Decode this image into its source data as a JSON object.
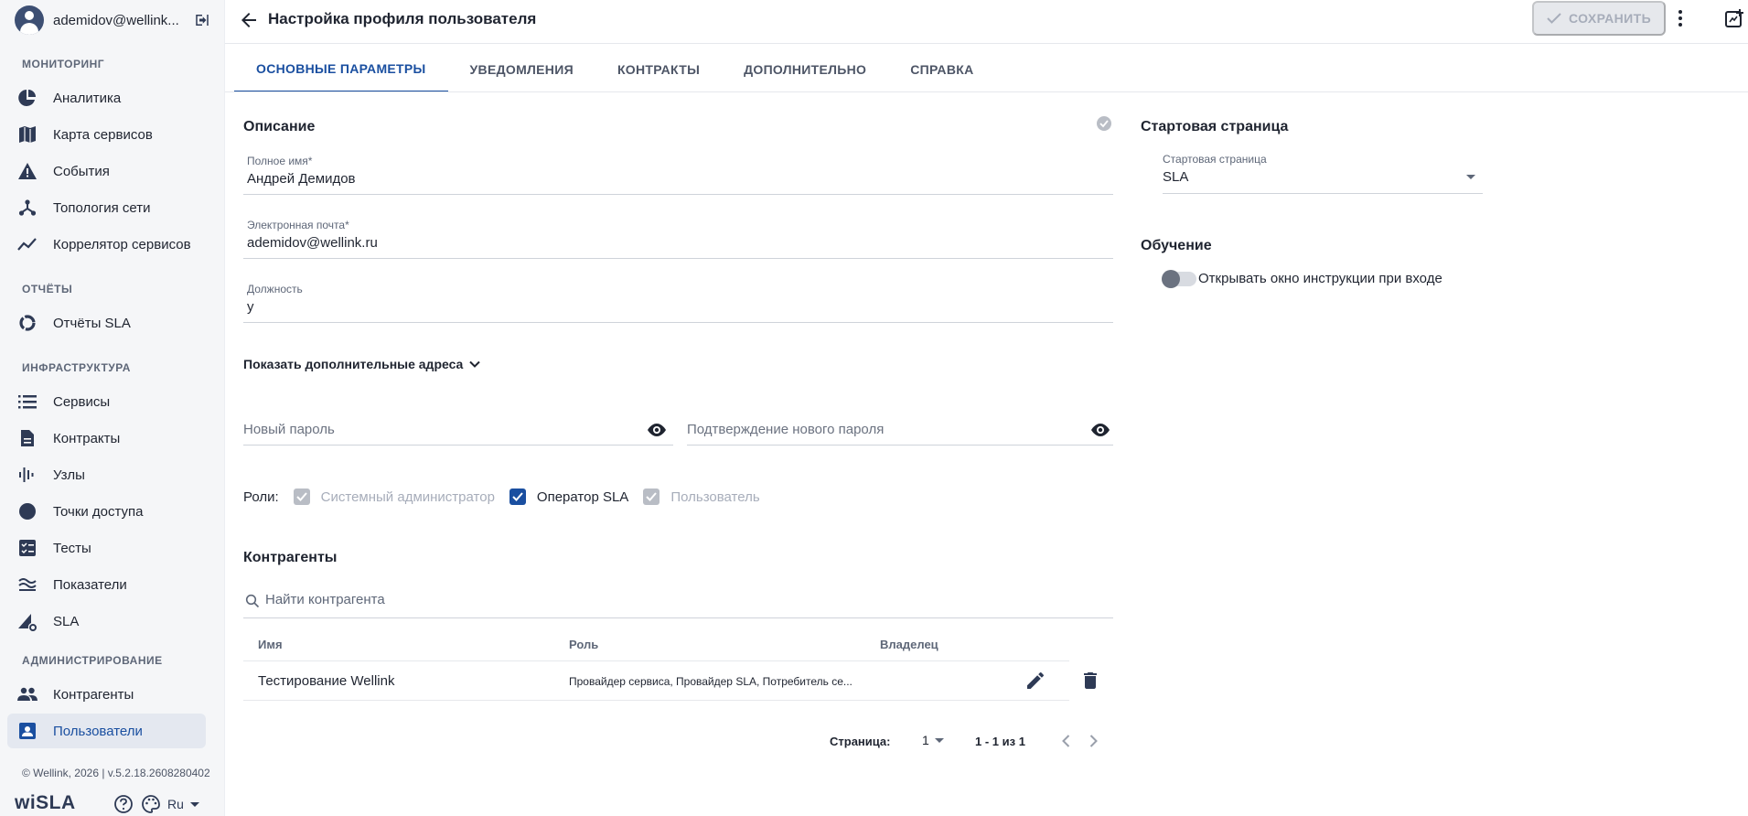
{
  "user": {
    "email": "ademidov@wellink..."
  },
  "sidebar": {
    "sections": [
      {
        "title": "МОНИТОРИНГ"
      },
      {
        "title": "ОТЧЁТЫ"
      },
      {
        "title": "ИНФРАСТРУКТУРА"
      },
      {
        "title": "АДМИНИСТРИРОВАНИЕ"
      }
    ],
    "items": [
      {
        "label": "Аналитика",
        "icon": "pie-chart-icon"
      },
      {
        "label": "Карта сервисов",
        "icon": "map-icon"
      },
      {
        "label": "События",
        "icon": "warning-icon"
      },
      {
        "label": "Топология сети",
        "icon": "topology-icon"
      },
      {
        "label": "Коррелятор сервисов",
        "icon": "trend-icon"
      },
      {
        "label": "Отчёты SLA",
        "icon": "donut-icon"
      },
      {
        "label": "Сервисы",
        "icon": "list-icon"
      },
      {
        "label": "Контракты",
        "icon": "document-icon"
      },
      {
        "label": "Узлы",
        "icon": "equalizer-icon"
      },
      {
        "label": "Точки доступа",
        "icon": "circle-icon"
      },
      {
        "label": "Тесты",
        "icon": "checklist-icon"
      },
      {
        "label": "Показатели",
        "icon": "waves-icon"
      },
      {
        "label": "SLA",
        "icon": "sla-gear-icon"
      },
      {
        "label": "Контрагенты",
        "icon": "people-icon"
      },
      {
        "label": "Пользователи",
        "icon": "user-card-icon",
        "active": true
      }
    ],
    "copyright": "© Wellink, 2026 | v.5.2.18.2608280402",
    "brand": "wiSLA",
    "language": "Ru"
  },
  "header": {
    "title": "Настройка профиля пользователя",
    "save_label": "СОХРАНИТЬ"
  },
  "tabs": [
    {
      "label": "ОСНОВНЫЕ ПАРАМЕТРЫ",
      "active": true
    },
    {
      "label": "УВЕДОМЛЕНИЯ"
    },
    {
      "label": "КОНТРАКТЫ"
    },
    {
      "label": "ДОПОЛНИТЕЛЬНО"
    },
    {
      "label": "СПРАВКА"
    }
  ],
  "description": {
    "title": "Описание",
    "full_name": {
      "label": "Полное имя*",
      "value": "Андрей Демидов"
    },
    "email": {
      "label": "Электронная почта*",
      "value": "ademidov@wellink.ru"
    },
    "position": {
      "label": "Должность",
      "value": "у"
    },
    "more_addresses": "Показать дополнительные адреса",
    "new_password": {
      "placeholder": "Новый пароль"
    },
    "confirm_password": {
      "placeholder": "Подтверждение нового пароля"
    }
  },
  "roles": {
    "label": "Роли:",
    "items": [
      {
        "label": "Системный администратор",
        "checked": true,
        "disabled": true
      },
      {
        "label": "Оператор SLA",
        "checked": true,
        "disabled": false
      },
      {
        "label": "Пользователь",
        "checked": true,
        "disabled": true
      }
    ]
  },
  "contractors": {
    "title": "Контрагенты",
    "search_placeholder": "Найти контрагента",
    "columns": [
      "Имя",
      "Роль",
      "Владелец"
    ],
    "rows": [
      {
        "name": "Тестирование Wellink",
        "role": "Провайдер сервиса, Провайдер SLA, Потребитель се...",
        "owner": ""
      }
    ],
    "pager": {
      "label": "Страница:",
      "page": "1",
      "range": "1 - 1 из 1"
    }
  },
  "start_page": {
    "title": "Стартовая страница",
    "field_label": "Стартовая страница",
    "value": "SLA"
  },
  "training": {
    "title": "Обучение",
    "toggle_label": "Открывать окно инструкции при входе",
    "enabled": false
  },
  "colors": {
    "accent": "#1a4fa0",
    "sidebar_bg": "#f5f6f8",
    "disabled": "#a7adba"
  }
}
